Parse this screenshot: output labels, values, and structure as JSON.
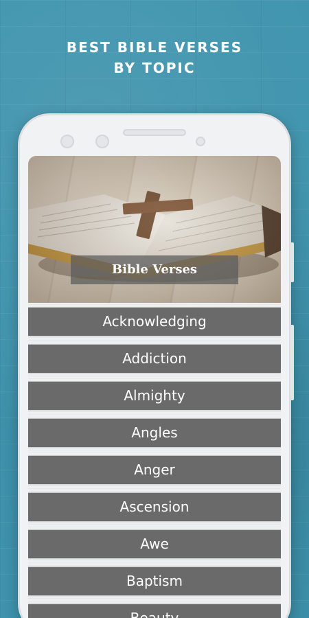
{
  "promo": {
    "headline_line1": "BEST BIBLE VERSES",
    "headline_line2": "BY TOPIC"
  },
  "hero": {
    "label": "Bible Verses"
  },
  "topics": [
    "Acknowledging",
    "Addiction",
    "Almighty",
    "Angles",
    "Anger",
    "Ascension",
    "Awe",
    "Baptism",
    "Beauty"
  ],
  "colors": {
    "background": "#3e93ad",
    "topic_button": "#6a6a6a",
    "topic_text": "#ffffff"
  }
}
